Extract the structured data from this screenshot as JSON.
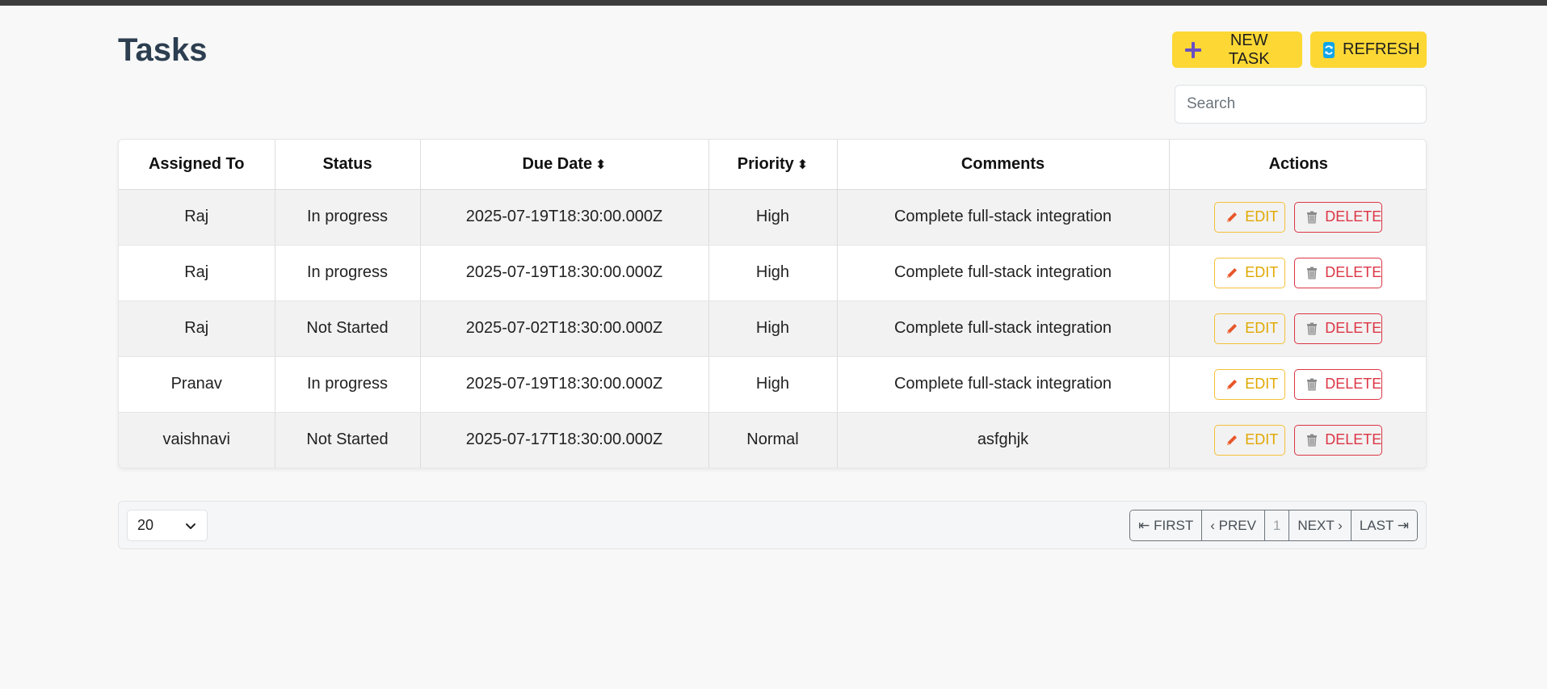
{
  "page": {
    "title": "Tasks"
  },
  "toolbar": {
    "new_task_label": "NEW TASK",
    "refresh_label": "REFRESH"
  },
  "search": {
    "placeholder": "Search",
    "value": ""
  },
  "table": {
    "columns": [
      "Assigned To",
      "Status",
      "Due Date",
      "Priority",
      "Comments",
      "Actions"
    ],
    "sortable": {
      "due_date": "⬍",
      "priority": "⬍"
    },
    "rows": [
      {
        "assigned_to": "Raj",
        "status": "In progress",
        "due_date": "2025-07-19T18:30:00.000Z",
        "priority": "High",
        "comments": "Complete full-stack integration"
      },
      {
        "assigned_to": "Raj",
        "status": "In progress",
        "due_date": "2025-07-19T18:30:00.000Z",
        "priority": "High",
        "comments": "Complete full-stack integration"
      },
      {
        "assigned_to": "Raj",
        "status": "Not Started",
        "due_date": "2025-07-02T18:30:00.000Z",
        "priority": "High",
        "comments": "Complete full-stack integration"
      },
      {
        "assigned_to": "Pranav",
        "status": "In progress",
        "due_date": "2025-07-19T18:30:00.000Z",
        "priority": "High",
        "comments": "Complete full-stack integration"
      },
      {
        "assigned_to": "vaishnavi",
        "status": "Not Started",
        "due_date": "2025-07-17T18:30:00.000Z",
        "priority": "Normal",
        "comments": "asfghjk"
      }
    ],
    "actions": {
      "edit_label": "EDIT",
      "delete_label": "DELETE"
    }
  },
  "pagination": {
    "page_size": "20",
    "first_label": "⇤ FIRST",
    "prev_label": "‹ PREV",
    "current_page": "1",
    "next_label": "NEXT ›",
    "last_label": "LAST ⇥"
  },
  "icons": {
    "new_task": "plus-icon",
    "refresh": "refresh-icon",
    "edit": "pencil-icon",
    "delete": "trash-icon",
    "page_size_toggle": "chevron-down-icon"
  },
  "colors": {
    "primary_button": "#fdd835",
    "edit_accent": "#f5c037",
    "delete_accent": "#dc3545",
    "title": "#2c3e50"
  }
}
